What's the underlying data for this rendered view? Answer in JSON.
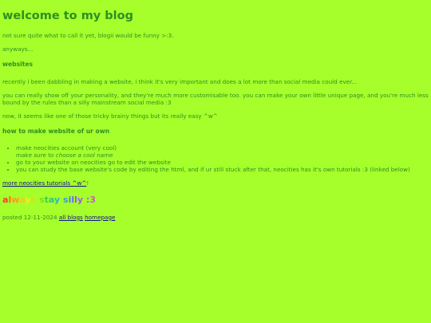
{
  "title": "welcome to my blog",
  "intro": "not sure quite what to call it yet, blogii would be funny >:3.",
  "anyways": "anyways...",
  "websites_heading": "websites",
  "para1": "recently i been dabbling in making a website, i think it's very important and does a lot more than social media could ever...",
  "para2": "you can really show off your personality, and they're much more customisable too. you can make your own little unique page, and you're much less bound by the rules than a silly mainstream social media :3",
  "para3": "now, it seems like one of those tricky brainy things but its really easy ^w^",
  "howto_heading": "how to make website of ur own",
  "steps": [
    {
      "text": "make neocities account (very cool)",
      "sub": "make sure to choose a cool name"
    },
    {
      "text": "go to your website on neocities go to edit the website",
      "sub": ""
    },
    {
      "text": "you can study the base website's code by editing the html, and if ur still stuck after that, neocities has it's own tutorials :3 (linked below)",
      "sub": ""
    }
  ],
  "tutorials_link": "more neocities tutorials ^w^",
  "tutorials_suffix": "!",
  "rainbow_text": "always stay silly :3",
  "rainbow_colors": [
    "#ff3b30",
    "#ff6a1f",
    "#ff9a1a",
    "#ffc61a",
    "#ffe81a",
    "#c8e81a",
    "#7edc2a",
    "#3fcf4a",
    "#2fc48a",
    "#2fb6c8",
    "#3a9be0",
    "#4a7ef0",
    "#6a66f5",
    "#8a5cf2",
    "#a25ae8",
    "#b65ad8",
    "#c85cc8",
    "#d85eb4",
    "#e466a0",
    "#ee6e8c"
  ],
  "footer": {
    "posted": "posted 12-11-2024",
    "all_blogs": "all blogs",
    "homepage": "homepage"
  }
}
